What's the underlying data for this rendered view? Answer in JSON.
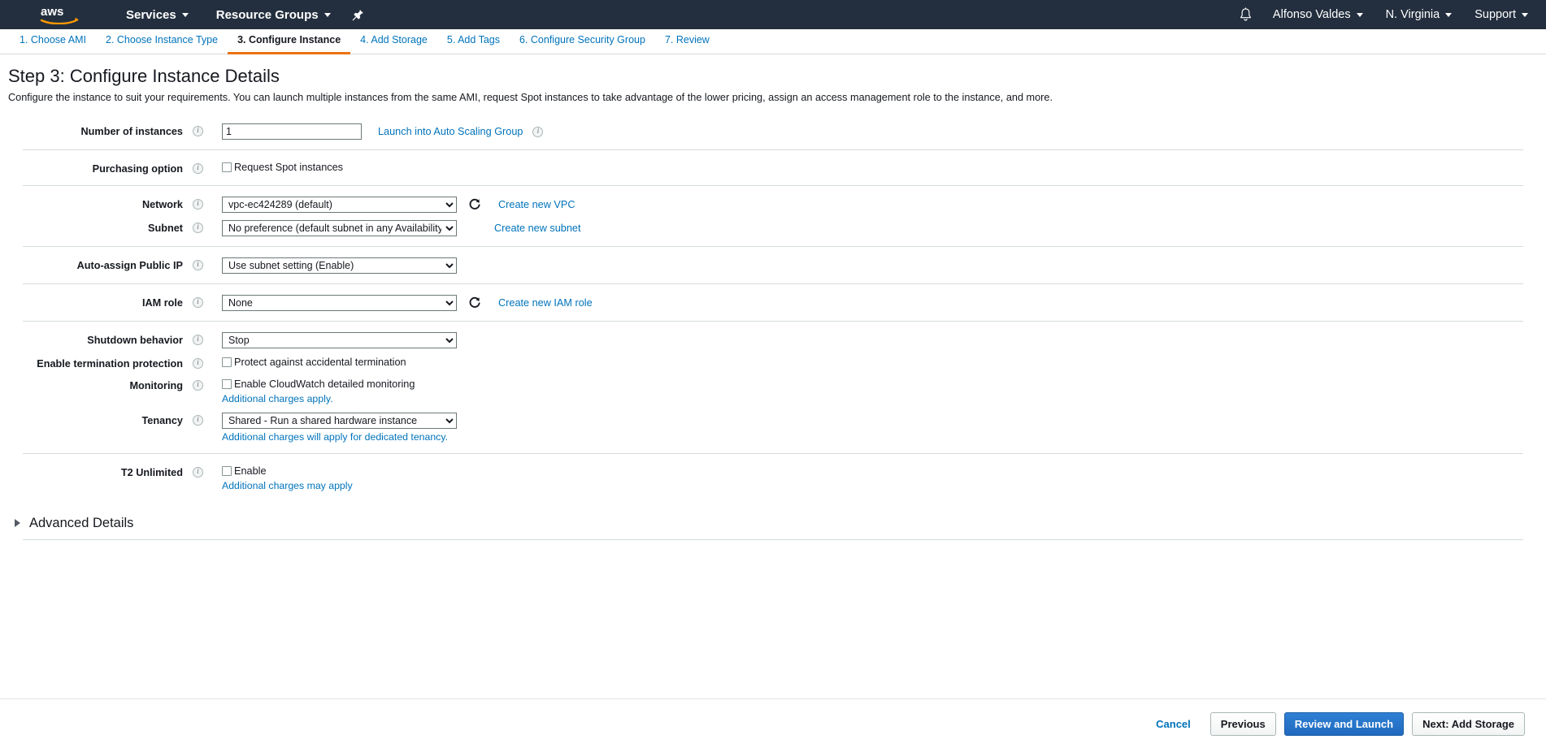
{
  "topnav": {
    "logo_alt": "aws",
    "left_items": [
      {
        "label": "Services",
        "has_caret": true
      },
      {
        "label": "Resource Groups",
        "has_caret": true
      }
    ],
    "pin_icon": "pin-icon",
    "bell_icon": "bell-icon",
    "right_items": [
      {
        "label": "Alfonso Valdes",
        "has_caret": true
      },
      {
        "label": "N. Virginia",
        "has_caret": true
      },
      {
        "label": "Support",
        "has_caret": true
      }
    ]
  },
  "wizard": {
    "tabs": [
      {
        "label": "1. Choose AMI",
        "active": false
      },
      {
        "label": "2. Choose Instance Type",
        "active": false
      },
      {
        "label": "3. Configure Instance",
        "active": true
      },
      {
        "label": "4. Add Storage",
        "active": false
      },
      {
        "label": "5. Add Tags",
        "active": false
      },
      {
        "label": "6. Configure Security Group",
        "active": false
      },
      {
        "label": "7. Review",
        "active": false
      }
    ],
    "active_accent": "#ec7211"
  },
  "page": {
    "title": "Step 3: Configure Instance Details",
    "description": "Configure the instance to suit your requirements. You can launch multiple instances from the same AMI, request Spot instances to take advantage of the lower pricing, assign an access management role to the instance, and more."
  },
  "form": {
    "number_of_instances": {
      "label": "Number of instances",
      "value": "1",
      "link": "Launch into Auto Scaling Group"
    },
    "purchasing_option": {
      "label": "Purchasing option",
      "checkbox_label": "Request Spot instances",
      "checked": false
    },
    "network": {
      "label": "Network",
      "value": "vpc-ec424289 (default)",
      "link": "Create new VPC",
      "refresh_icon": "refresh-icon"
    },
    "subnet": {
      "label": "Subnet",
      "value": "No preference (default subnet in any Availability Zone)",
      "link": "Create new subnet"
    },
    "auto_assign_public_ip": {
      "label": "Auto-assign Public IP",
      "value": "Use subnet setting (Enable)"
    },
    "iam_role": {
      "label": "IAM role",
      "value": "None",
      "link": "Create new IAM role",
      "refresh_icon": "refresh-icon"
    },
    "shutdown_behavior": {
      "label": "Shutdown behavior",
      "value": "Stop"
    },
    "termination_protection": {
      "label": "Enable termination protection",
      "checkbox_label": "Protect against accidental termination",
      "checked": false
    },
    "monitoring": {
      "label": "Monitoring",
      "checkbox_label": "Enable CloudWatch detailed monitoring",
      "checked": false,
      "note_link": "Additional charges apply."
    },
    "tenancy": {
      "label": "Tenancy",
      "value": "Shared - Run a shared hardware instance",
      "note_link": "Additional charges will apply for dedicated tenancy."
    },
    "t2_unlimited": {
      "label": "T2 Unlimited",
      "checkbox_label": "Enable",
      "checked": false,
      "note_link": "Additional charges may apply"
    },
    "advanced_details": {
      "label": "Advanced Details",
      "expanded": false,
      "icon": "triangle-right-icon"
    }
  },
  "footer": {
    "cancel": "Cancel",
    "previous": "Previous",
    "review_and_launch": "Review and Launch",
    "next": "Next: Add Storage",
    "primary_color": "#2069bf"
  }
}
